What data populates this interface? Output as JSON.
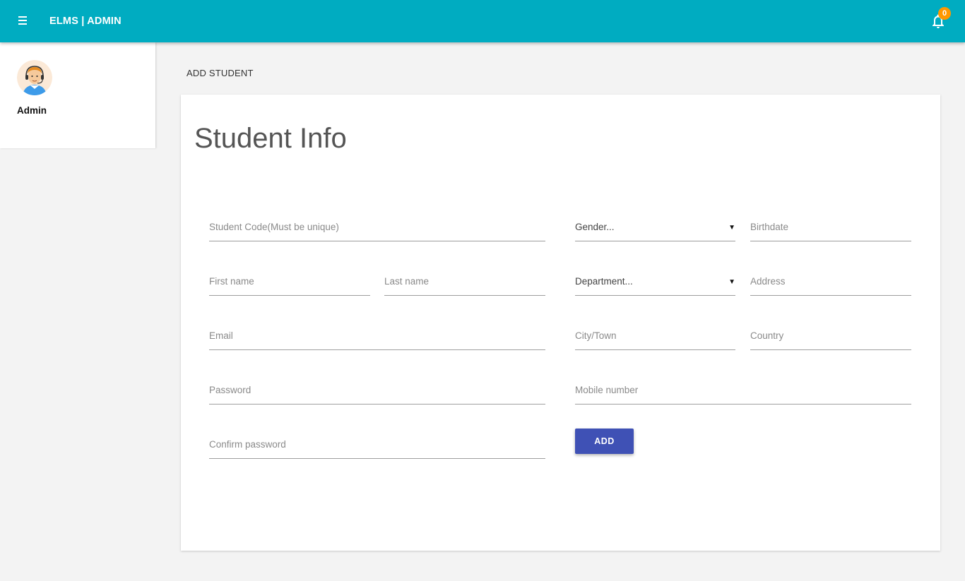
{
  "header": {
    "brand": "ELMS | ADMIN",
    "notification_count": "0",
    "accent_color": "#00acc1",
    "badge_color": "#ff9800",
    "menu_icon": "hamburger-menu-icon",
    "bell_icon": "bell-icon"
  },
  "sidebar": {
    "user_name": "Admin",
    "avatar_icon": "user-avatar"
  },
  "page": {
    "title": "ADD STUDENT"
  },
  "form": {
    "heading": "Student Info",
    "fields": {
      "student_code": "Student Code(Must be unique)",
      "first_name": "First name",
      "last_name": "Last name",
      "email": "Email",
      "password": "Password",
      "confirm_password": "Confirm password",
      "gender": "Gender...",
      "birthdate": "Birthdate",
      "department": "Department...",
      "address": "Address",
      "city": "City/Town",
      "country": "Country",
      "mobile": "Mobile number"
    },
    "submit_label": "ADD",
    "button_color": "#3f51b5"
  }
}
